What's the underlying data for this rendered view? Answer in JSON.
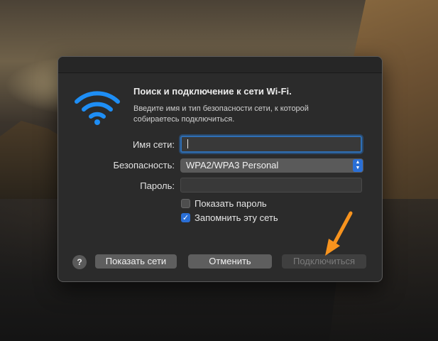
{
  "dialog": {
    "title": "Поиск и подключение к сети Wi-Fi.",
    "description_line1": "Введите имя и тип безопасности сети, к которой",
    "description_line2": "собираетесь подключиться.",
    "wifi_icon": "wifi-icon"
  },
  "form": {
    "network_name_label": "Имя сети:",
    "network_name_value": "",
    "security_label": "Безопасность:",
    "security_value": "WPA2/WPA3 Personal",
    "password_label": "Пароль:",
    "password_value": "",
    "show_password_label": "Показать пароль",
    "show_password_checked": false,
    "remember_network_label": "Запомнить эту сеть",
    "remember_network_checked": true
  },
  "buttons": {
    "help": "?",
    "show_networks": "Показать сети",
    "cancel": "Отменить",
    "connect": "Подключиться"
  },
  "colors": {
    "accent": "#2a6fd6",
    "annotation_arrow": "#f7931e",
    "dialog_bg": "#2b2b2b"
  }
}
